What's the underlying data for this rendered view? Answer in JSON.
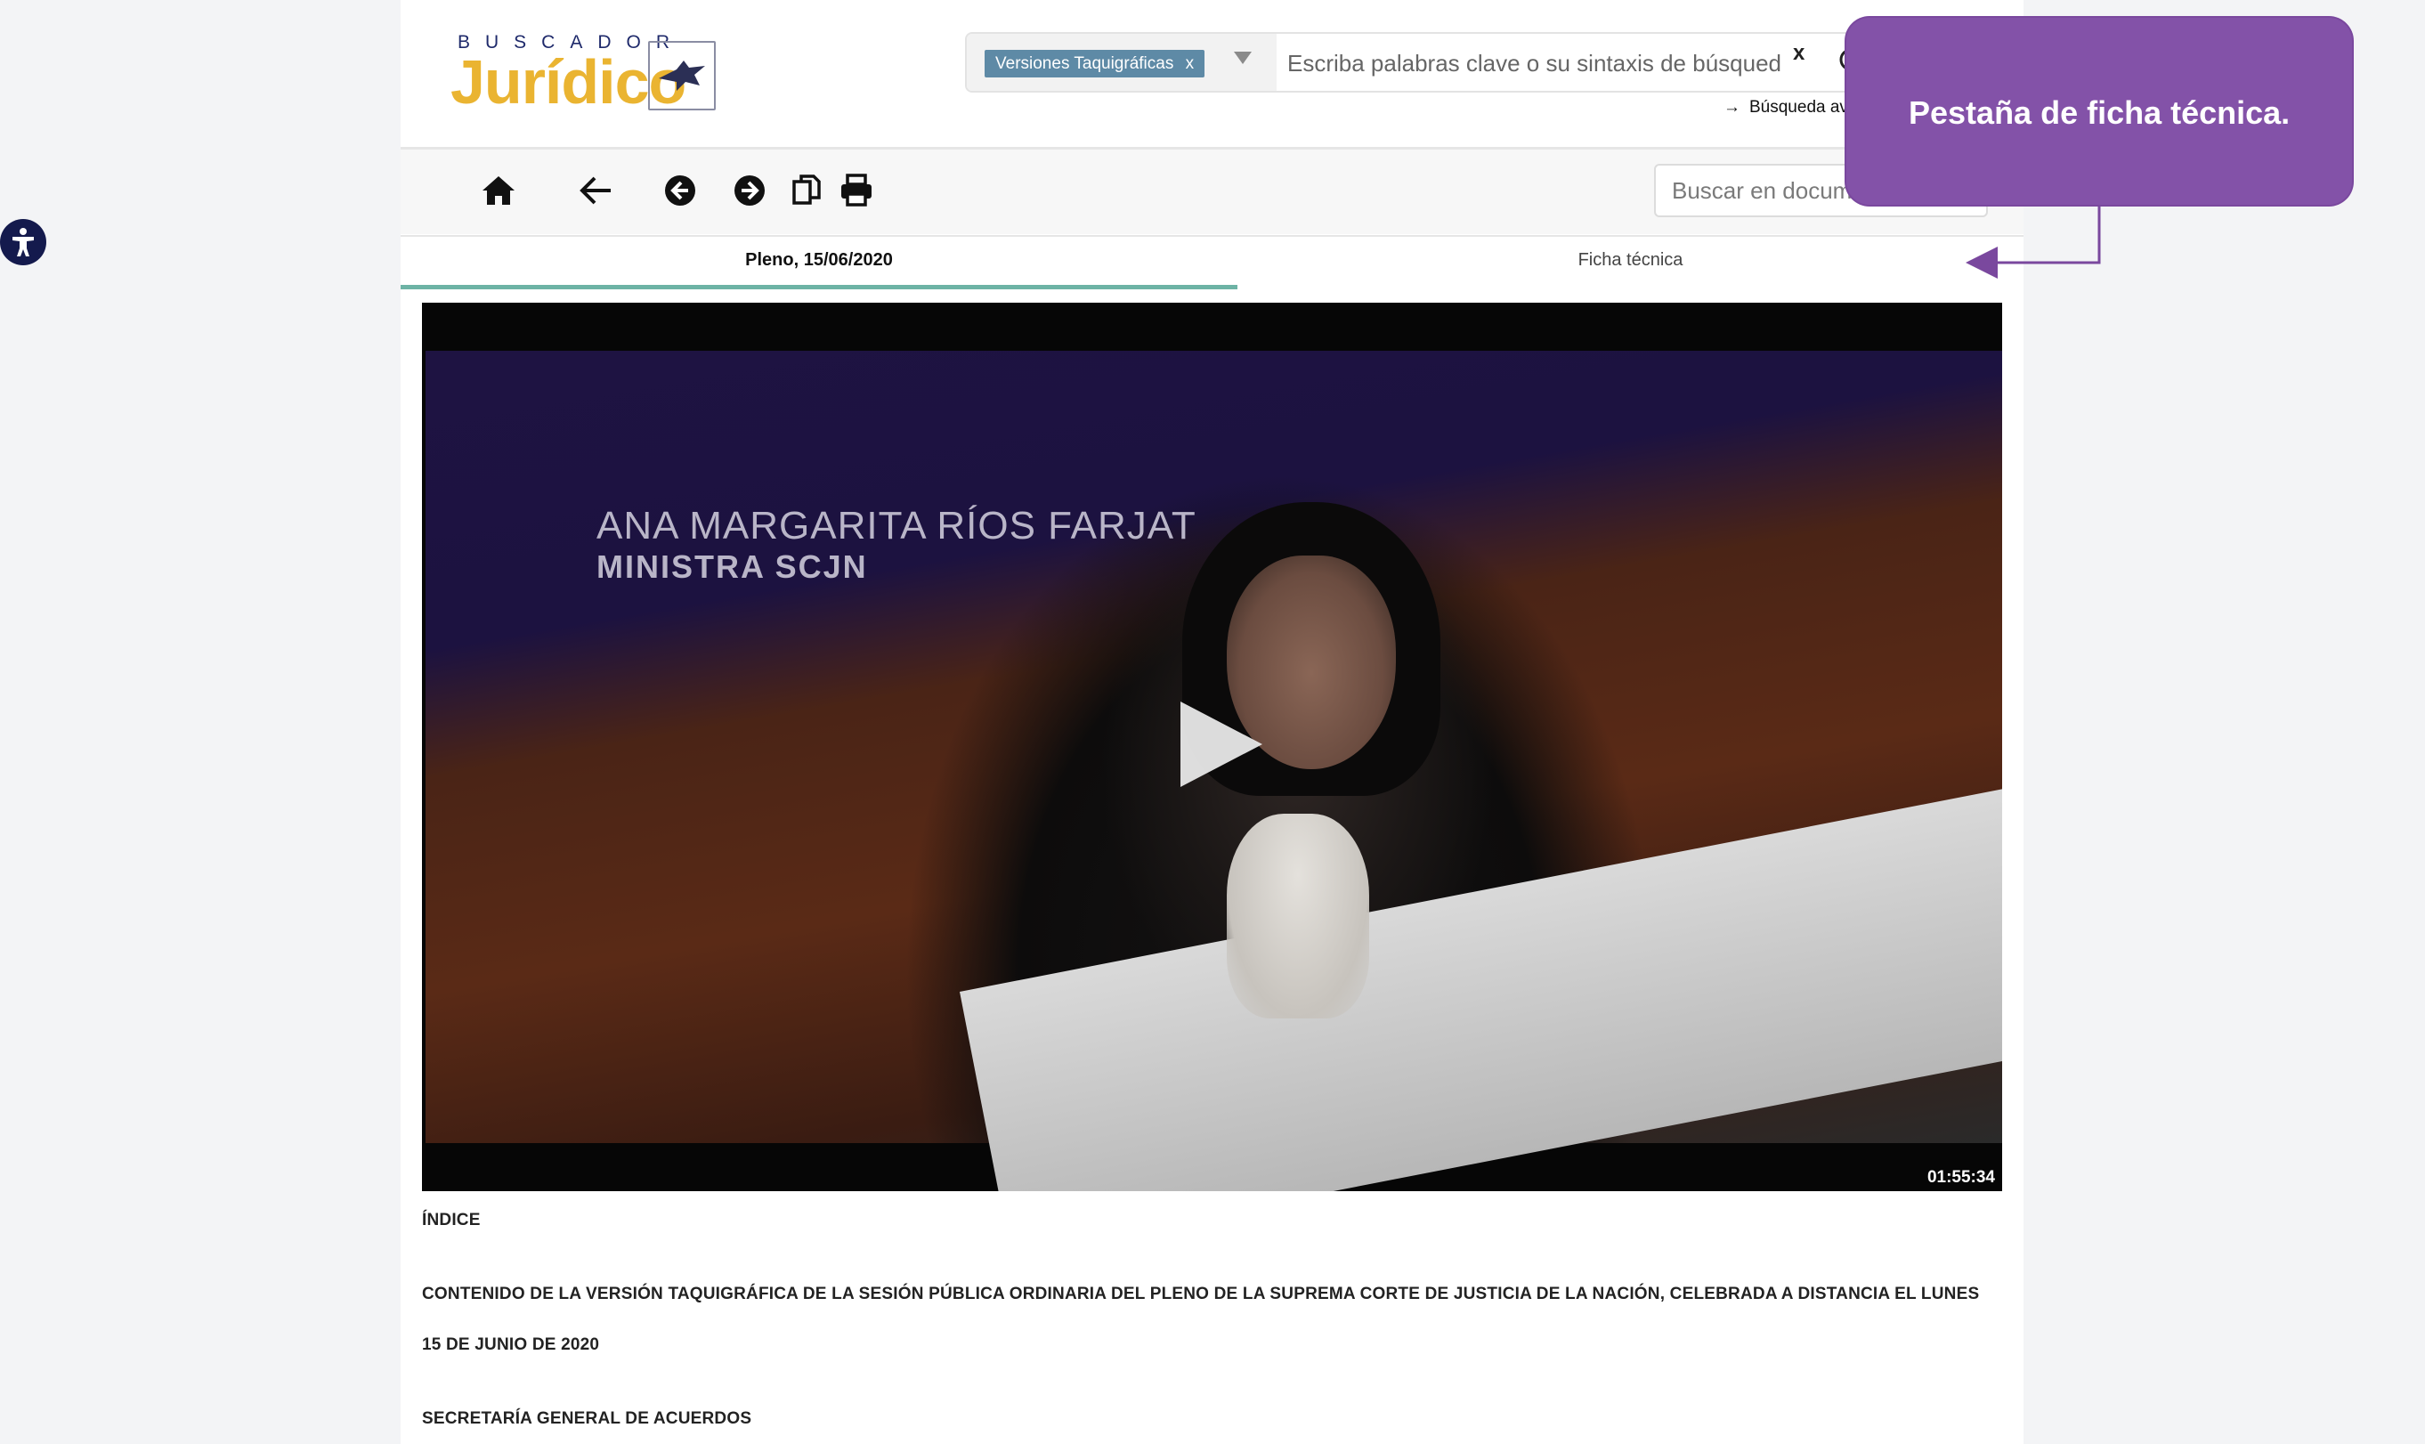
{
  "header": {
    "logo_top": "BUSCADOR",
    "logo_main": "Jurídico",
    "search": {
      "filter_tag": "Versiones Taquigráficas",
      "filter_tag_remove": "x",
      "placeholder": "Escriba palabras clave o su sintaxis de búsqued",
      "clear_label": "x"
    },
    "advanced_search": "Búsqueda avanzada",
    "advanced_arrow": "→"
  },
  "toolbar": {
    "icons": [
      "home-icon",
      "back-arrow-icon",
      "circle-left-icon",
      "circle-right-icon",
      "copy-icon",
      "print-icon"
    ],
    "doc_search_placeholder": "Buscar en documento"
  },
  "tabs": [
    {
      "label": "Pleno, 15/06/2020",
      "active": true
    },
    {
      "label": "Ficha técnica",
      "active": false
    }
  ],
  "video": {
    "caption_name": "ANA MARGARITA RÍOS FARJAT",
    "caption_title": "MINISTRA SCJN",
    "duration": "01:55:34"
  },
  "document": {
    "index_label": "ÍNDICE",
    "paragraph_line1": "CONTENIDO DE LA VERSIÓN TAQUIGRÁFICA DE LA SESIÓN PÚBLICA ORDINARIA DEL PLENO DE LA SUPREMA CORTE DE JUSTICIA DE LA NACIÓN, CELEBRADA A DISTANCIA EL LUNES",
    "paragraph_line2": "15 DE JUNIO DE 2020",
    "section": "SECRETARÍA GENERAL DE ACUERDOS"
  },
  "tooltip": {
    "text": "Pestaña de ficha técnica.",
    "color": "#8352a8"
  },
  "colors": {
    "accent_tab": "#6db3a5",
    "tag_bg": "#5e8aa6",
    "logo_gold": "#eab431",
    "logo_navy": "#1f2a6b"
  }
}
